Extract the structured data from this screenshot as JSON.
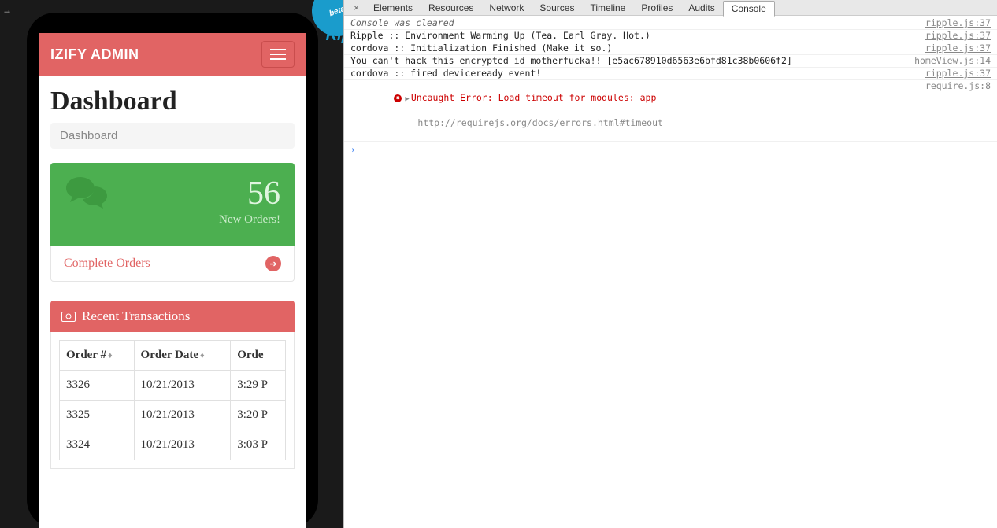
{
  "emulator": {
    "badge": "beta",
    "brand": "Ripp"
  },
  "app": {
    "header_title": "IZIFY ADMIN",
    "page_title": "Dashboard",
    "breadcrumb": "Dashboard",
    "orders_card": {
      "count": "56",
      "label": "New Orders!",
      "footer": "Complete Orders"
    },
    "transactions": {
      "title": "Recent Transactions",
      "columns": [
        "Order #",
        "Order Date",
        "Orde"
      ],
      "rows": [
        {
          "id": "3326",
          "date": "10/21/2013",
          "time": "3:29 P"
        },
        {
          "id": "3325",
          "date": "10/21/2013",
          "time": "3:20 P"
        },
        {
          "id": "3324",
          "date": "10/21/2013",
          "time": "3:03 P"
        }
      ]
    }
  },
  "devtools": {
    "tabs": [
      "Elements",
      "Resources",
      "Network",
      "Sources",
      "Timeline",
      "Profiles",
      "Audits",
      "Console"
    ],
    "active_tab": "Console",
    "logs": [
      {
        "msg": "Console was cleared",
        "src": "ripple.js:37",
        "style": "italic"
      },
      {
        "msg": "Ripple :: Environment Warming Up (Tea. Earl Gray. Hot.)",
        "src": "ripple.js:37"
      },
      {
        "msg": "cordova :: Initialization Finished (Make it so.)",
        "src": "ripple.js:37"
      },
      {
        "msg": "You can't hack this encrypted id motherfucka!! [e5ac678910d6563e6bfd81c38b0606f2]",
        "src": "homeView.js:14"
      },
      {
        "msg": "cordova :: fired deviceready event!",
        "src": "ripple.js:37"
      }
    ],
    "error": {
      "msg": "Uncaught Error: Load timeout for modules: app",
      "sub": "http://requirejs.org/docs/errors.html#timeout",
      "src": "require.js:8"
    }
  }
}
